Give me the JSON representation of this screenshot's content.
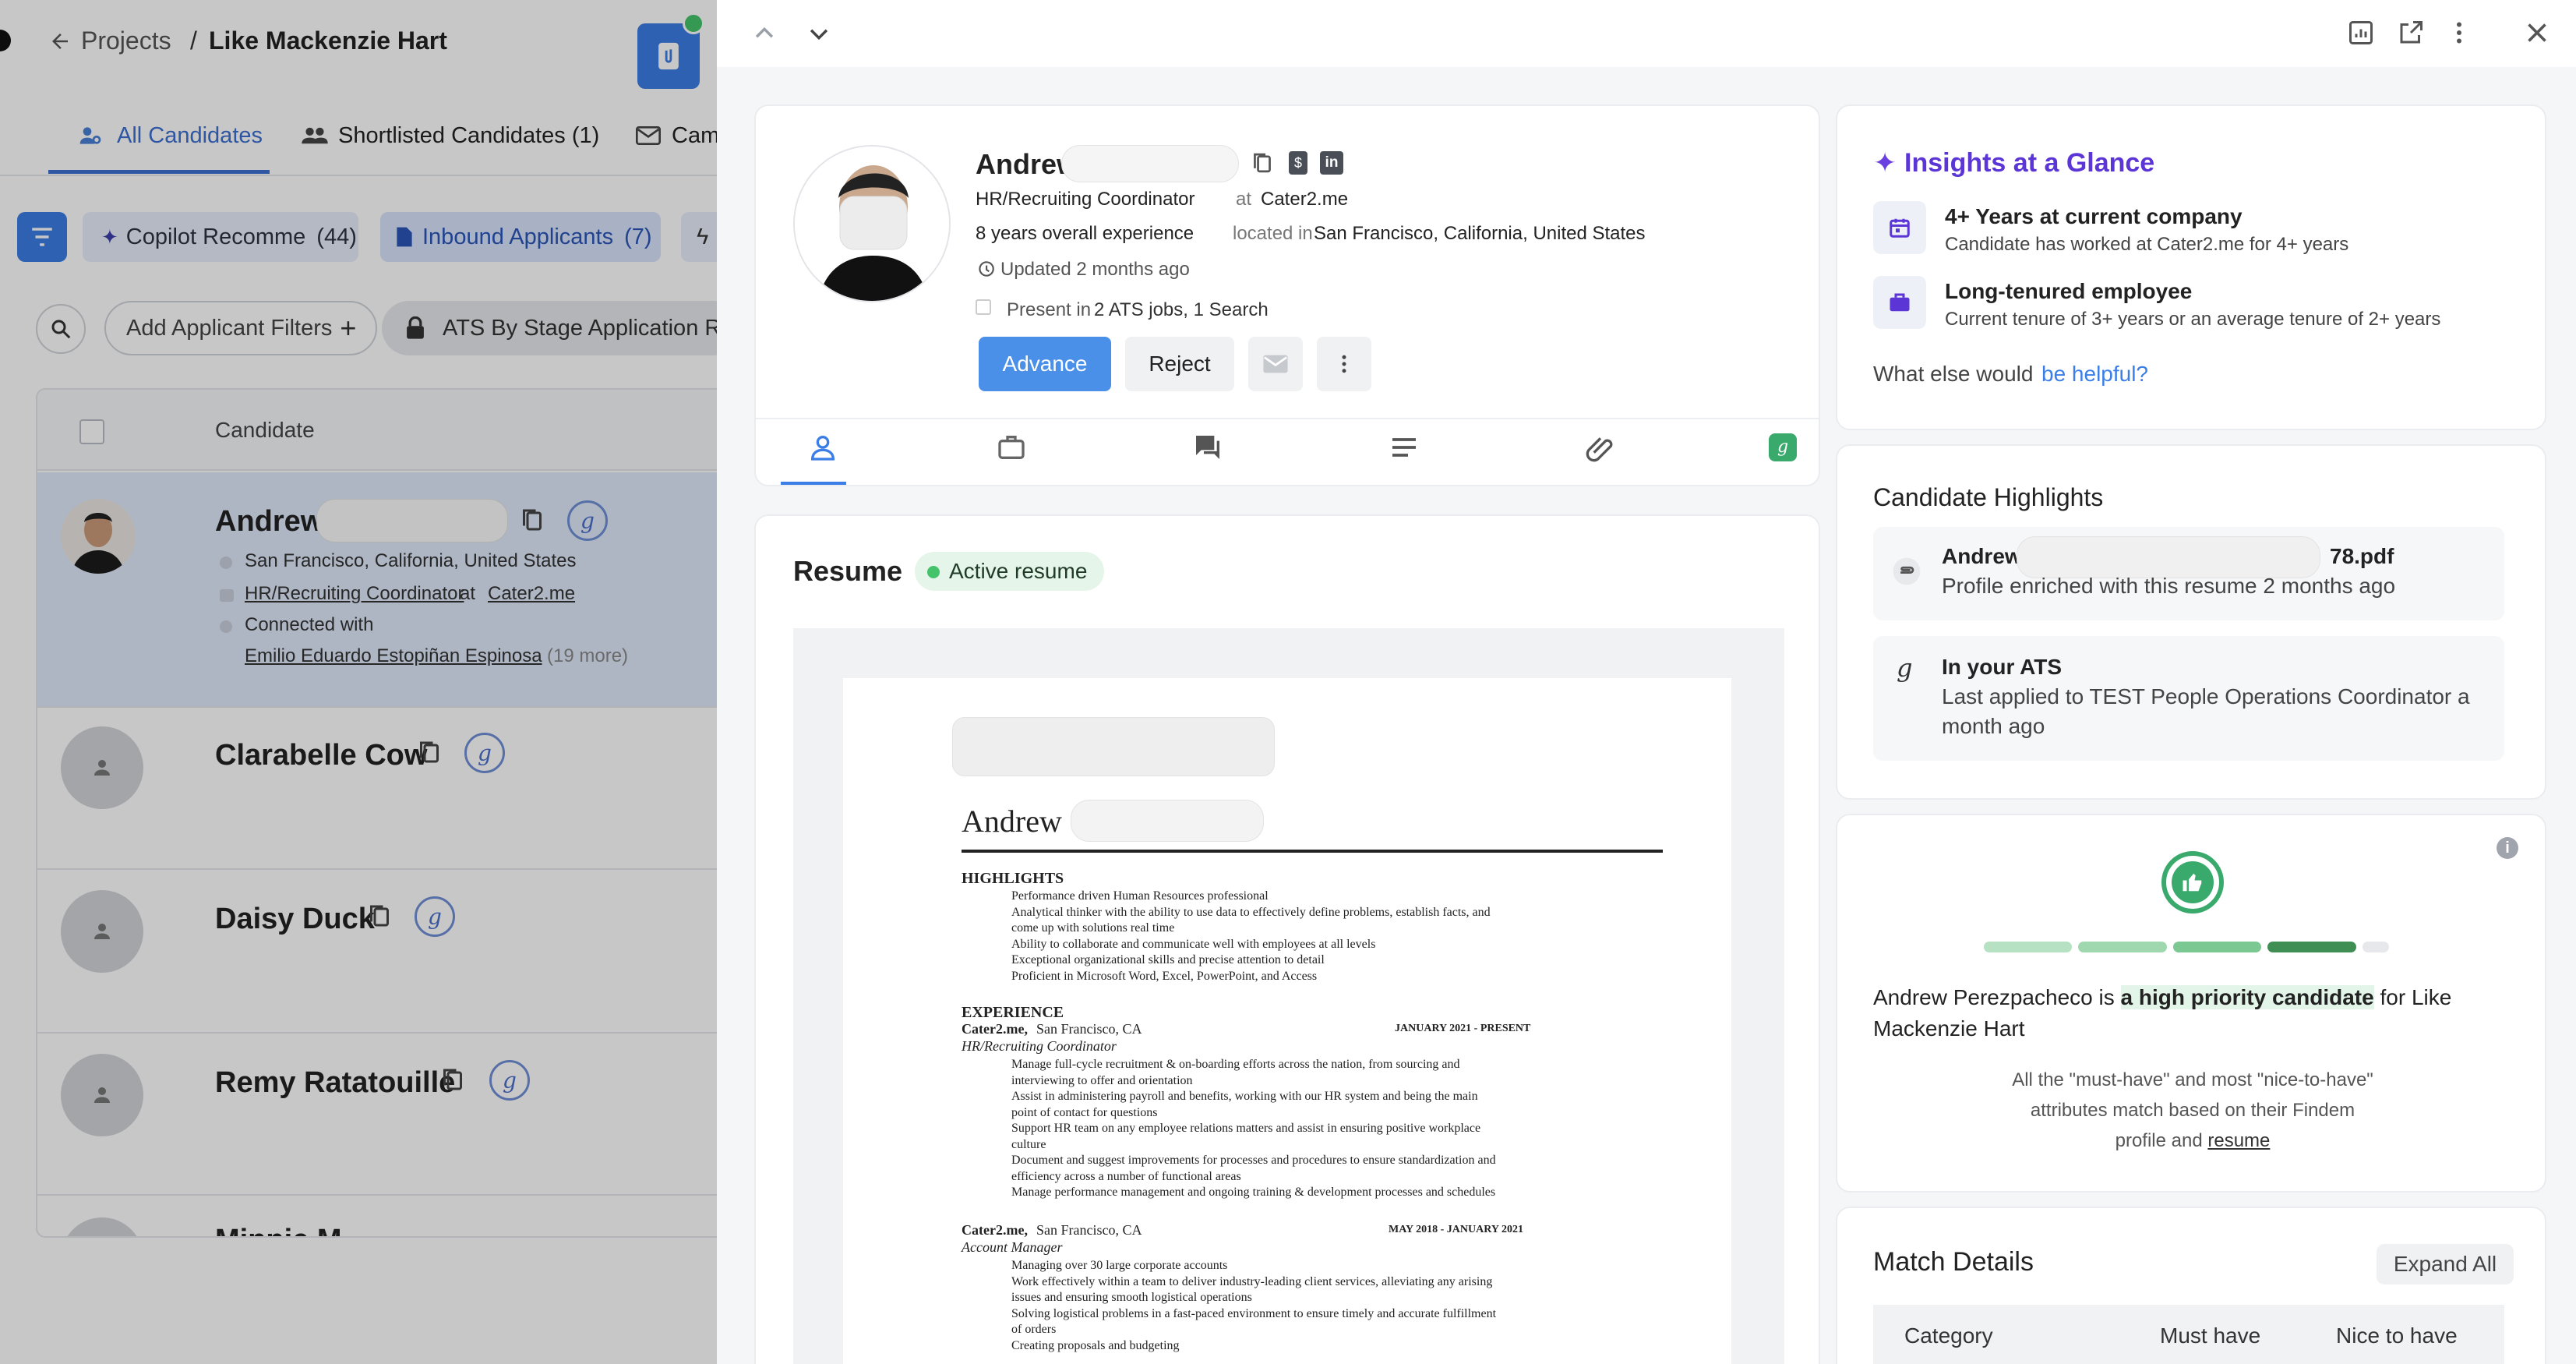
{
  "left": {
    "breadcrumb": {
      "projects": "Projects",
      "separator": "/",
      "project": "Like Mackenzie Hart"
    },
    "tabs": [
      {
        "label": "All Candidates"
      },
      {
        "label": "Shortlisted Candidates (1)"
      },
      {
        "label": "Cam"
      }
    ],
    "filters": {
      "copilot": {
        "label": "Copilot Recomme",
        "count": "(44)"
      },
      "inbound": {
        "label": "Inbound Applicants",
        "count": "(7)"
      },
      "add_filters": "Add Applicant Filters",
      "ats_stage": "ATS By Stage Application Re"
    },
    "table": {
      "column_candidate": "Candidate"
    },
    "candidates": [
      {
        "name": "Andrew",
        "location": "San Francisco, California, United States",
        "title": "HR/Recruiting Coordinator",
        "at": "at",
        "company": "Cater2.me",
        "connected_label": "Connected with",
        "connected_name": "Emilio Eduardo Estopiñan Espinosa",
        "connected_more": "(19 more)"
      },
      {
        "name": "Clarabelle Cow"
      },
      {
        "name": "Daisy Duck"
      },
      {
        "name": "Remy Ratatouille"
      },
      {
        "name": "Minnie M"
      }
    ]
  },
  "drawer": {
    "profile": {
      "first_name": "Andrew",
      "title": "HR/Recruiting Coordinator",
      "at": "at",
      "company": "Cater2.me",
      "experience": "8 years overall experience",
      "located_in": "located in",
      "location": "San Francisco, California, United States",
      "updated": "Updated 2 months ago",
      "present_in": "Present in",
      "present_detail": "2 ATS jobs, 1 Search",
      "advance": "Advance",
      "reject": "Reject"
    },
    "resume": {
      "heading": "Resume",
      "badge": "Active resume",
      "doc": {
        "name": "Andrew",
        "highlights_heading": "HIGHLIGHTS",
        "highlights": [
          "Performance driven Human Resources professional",
          "Analytical thinker with the ability to use data to effectively define problems, establish facts, and",
          "come up with solutions real time",
          "Ability to collaborate and communicate well with employees at all levels",
          "Exceptional organizational skills and precise attention to detail",
          "Proficient in Microsoft Word, Excel, PowerPoint, and Access"
        ],
        "experience_heading": "EXPERIENCE",
        "job1_company": "Cater2.me,",
        "job1_place": "San Francisco, CA",
        "job1_dates": "JANUARY 2021 - PRESENT",
        "job1_title": "HR/Recruiting Coordinator",
        "job1_lines": [
          "Manage full-cycle recruitment & on-boarding efforts across the nation, from sourcing and",
          "interviewing to offer and orientation",
          "Assist in administering payroll and benefits, working with our HR system and being the main",
          "point of contact for questions",
          "Support HR team on any employee relations matters and assist in ensuring positive workplace",
          "culture",
          "Document and suggest improvements for processes and procedures to ensure standardization and",
          "efficiency across a number of functional areas",
          "Manage performance management and ongoing training & development processes and schedules"
        ],
        "job2_company": "Cater2.me,",
        "job2_place": "San Francisco, CA",
        "job2_dates": "MAY 2018 - JANUARY 2021",
        "job2_title": "Account Manager",
        "job2_lines": [
          "Managing over 30 large corporate accounts",
          "Work effectively within a team to deliver industry-leading client services, alleviating any arising",
          "issues and ensuring smooth logistical operations",
          "Solving logistical problems in a fast-paced environment to ensure timely and accurate fulfillment",
          "of orders",
          "Creating proposals and budgeting"
        ]
      }
    },
    "insights": {
      "title": "Insights at a Glance",
      "items": [
        {
          "title": "4+ Years at current company",
          "desc": "Candidate has worked at Cater2.me for 4+ years"
        },
        {
          "title": "Long-tenured employee",
          "desc": "Current tenure of 3+ years or an average tenure of 2+ years"
        }
      ],
      "helpful_prefix": "What else would",
      "helpful_link": "be helpful?"
    },
    "highlights": {
      "title": "Candidate Highlights",
      "resume_file_prefix": "Andrew_",
      "resume_file_suffix": "78.pdf",
      "resume_desc": "Profile enriched with this resume 2 months ago",
      "ats_title": "In your ATS",
      "ats_desc_1": "Last applied to TEST People Operations Coordinator a",
      "ats_desc_2": "month ago"
    },
    "priority": {
      "score_segments_filled": 4,
      "score_segments_total": 5,
      "name": "Andrew Perezpacheco",
      "is": "is",
      "emphasis": "a high priority candidate",
      "for_prefix": "for Like",
      "for_project": "Mackenzie Hart",
      "note_1": "All the \"must-have\" and most \"nice-to-have\"",
      "note_2": "attributes match based on their Findem",
      "note_3_prefix": "profile and",
      "note_3_link": "resume"
    },
    "match": {
      "title": "Match Details",
      "expand_all": "Expand All",
      "columns": [
        "Category",
        "Must have",
        "Nice to have"
      ]
    }
  },
  "colors": {
    "primary": "#4a8fe8",
    "accent_purple": "#6a3fe0",
    "green": "#3aaa6c",
    "link": "#3b7ee8"
  }
}
